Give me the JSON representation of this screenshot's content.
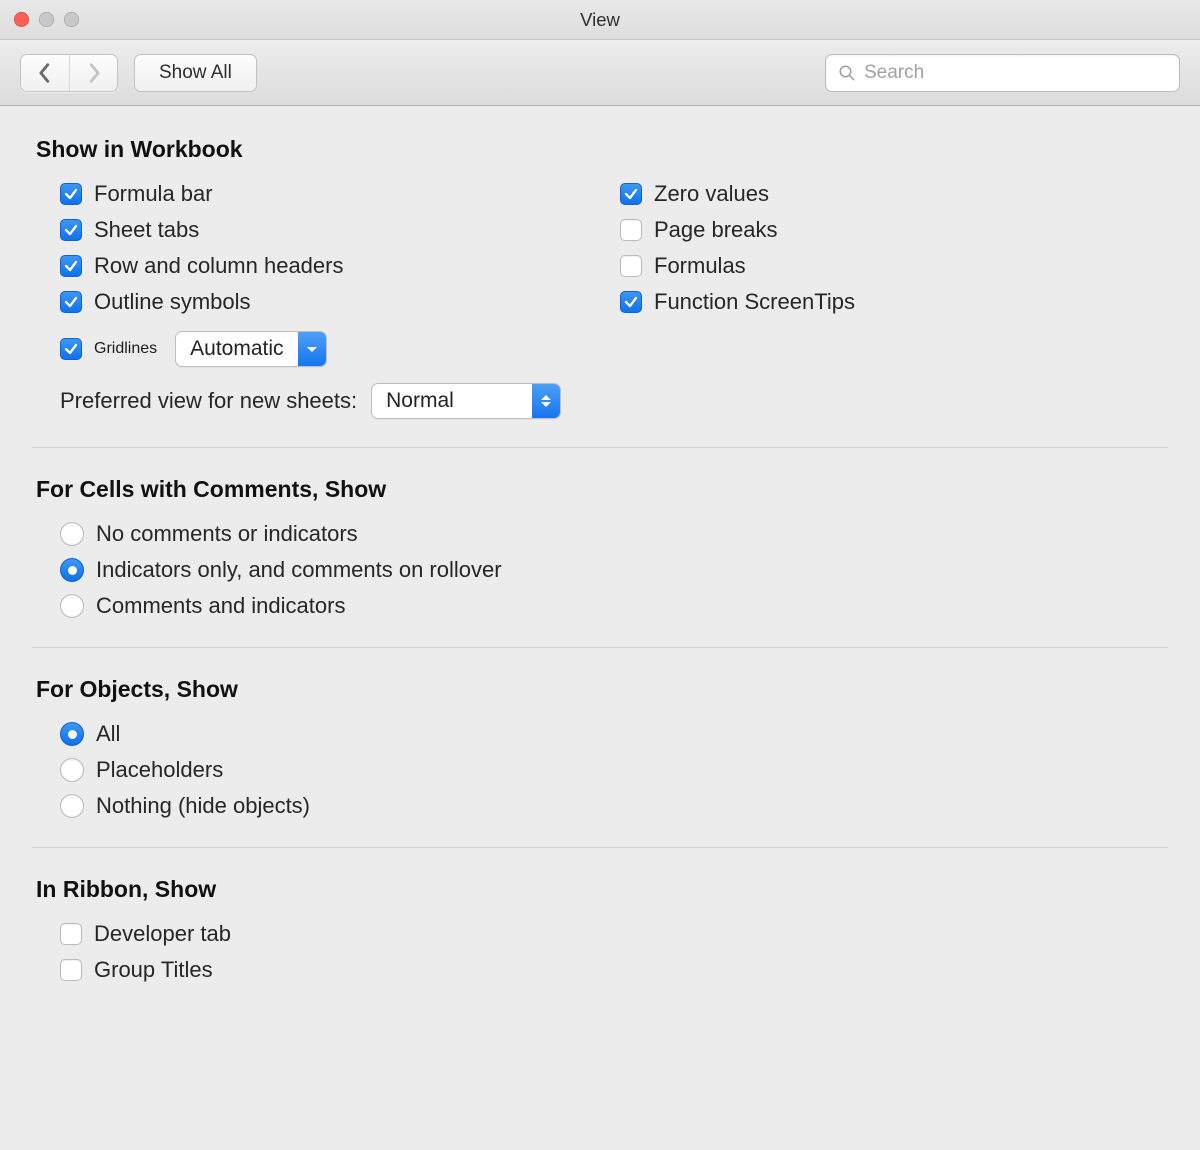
{
  "window": {
    "title": "View"
  },
  "toolbar": {
    "show_all_label": "Show All",
    "search_placeholder": "Search"
  },
  "sections": {
    "show_in_workbook": {
      "title": "Show in Workbook",
      "left": [
        {
          "label": "Formula bar",
          "checked": true
        },
        {
          "label": "Sheet tabs",
          "checked": true
        },
        {
          "label": "Row and column headers",
          "checked": true
        },
        {
          "label": "Outline symbols",
          "checked": true
        }
      ],
      "gridlines": {
        "label": "Gridlines",
        "checked": true,
        "dropdown": "Automatic"
      },
      "right": [
        {
          "label": "Zero values",
          "checked": true
        },
        {
          "label": "Page breaks",
          "checked": false
        },
        {
          "label": "Formulas",
          "checked": false
        },
        {
          "label": "Function ScreenTips",
          "checked": true
        }
      ],
      "preferred_view": {
        "label": "Preferred view for new sheets:",
        "value": "Normal"
      }
    },
    "comments": {
      "title": "For Cells with Comments, Show",
      "options": [
        {
          "label": "No comments or indicators",
          "selected": false
        },
        {
          "label": "Indicators only, and comments on rollover",
          "selected": true
        },
        {
          "label": "Comments and indicators",
          "selected": false
        }
      ]
    },
    "objects": {
      "title": "For Objects, Show",
      "options": [
        {
          "label": "All",
          "selected": true
        },
        {
          "label": "Placeholders",
          "selected": false
        },
        {
          "label": "Nothing (hide objects)",
          "selected": false
        }
      ]
    },
    "ribbon": {
      "title": "In Ribbon, Show",
      "options": [
        {
          "label": "Developer tab",
          "checked": false
        },
        {
          "label": "Group Titles",
          "checked": false
        }
      ]
    }
  }
}
